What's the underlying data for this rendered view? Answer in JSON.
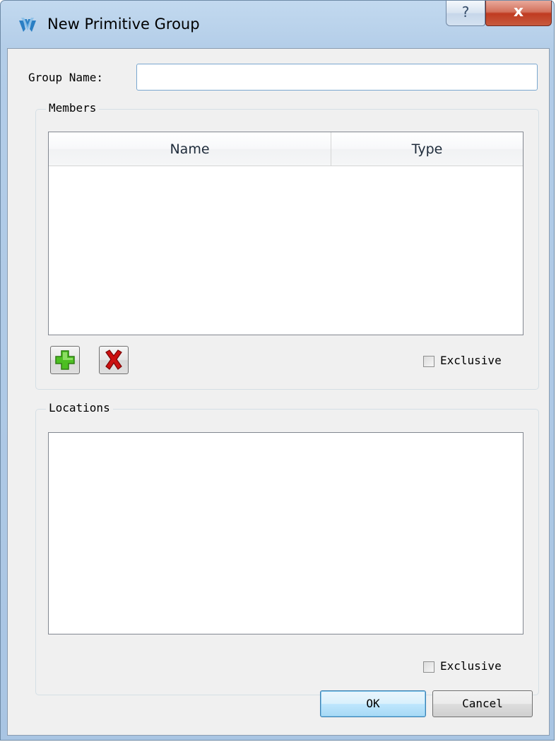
{
  "window": {
    "title": "New Primitive Group",
    "help_label": "?",
    "close_label": "x"
  },
  "form": {
    "group_name_label": "Group Name:",
    "group_name_value": ""
  },
  "members": {
    "caption": "Members",
    "columns": [
      "Name",
      "Type"
    ],
    "rows": [],
    "add_icon": "green-plus-icon",
    "remove_icon": "red-x-icon",
    "exclusive_label": "Exclusive",
    "exclusive_checked": false
  },
  "locations": {
    "caption": "Locations",
    "items": [],
    "exclusive_label": "Exclusive",
    "exclusive_checked": false
  },
  "buttons": {
    "ok": "OK",
    "cancel": "Cancel"
  },
  "colors": {
    "title_bar": "#b3cde8",
    "close_button": "#c03b21",
    "default_button": "#bee6fd",
    "add_icon": "#4cbf22",
    "remove_icon": "#cc1010"
  }
}
